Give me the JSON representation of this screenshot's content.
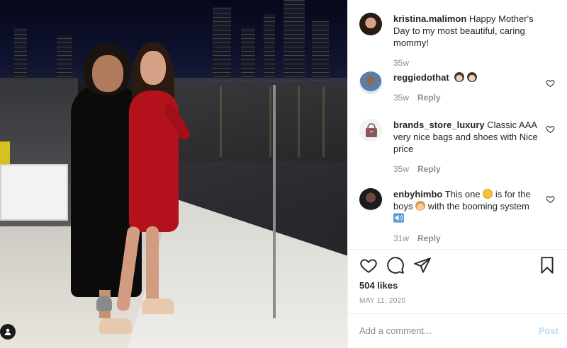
{
  "post": {
    "author": "kristina.malimon",
    "caption": "Happy Mother's Day to my most beautiful, caring mommy!",
    "caption_age": "35w"
  },
  "comments": [
    {
      "username": "reggiedothat",
      "text": "",
      "emoji": [
        "smiling-woman-emoji",
        "smiling-woman-emoji"
      ],
      "age": "35w",
      "reply_label": "Reply",
      "avatar_icon": "user-avatar-photo"
    },
    {
      "username": "brands_store_luxury",
      "text": "Classic AAA very nice bags and shoes with Nice price",
      "age": "35w",
      "reply_label": "Reply",
      "avatar_icon": "handbag-avatar"
    },
    {
      "username": "enbyhimbo",
      "text_part1": "This one",
      "text_part2": "is for the boys",
      "text_part3": "with the booming system",
      "age": "31w",
      "reply_label": "Reply",
      "avatar_icon": "user-avatar-photo"
    }
  ],
  "stats": {
    "likes": "504 likes",
    "date": "MAY 11, 2020"
  },
  "composer": {
    "placeholder": "Add a comment...",
    "post_label": "Post"
  },
  "colors": {
    "text": "#262626",
    "muted": "#8e8e8e",
    "post_disabled": "#b2dffc",
    "dress_red": "#b3121d"
  }
}
